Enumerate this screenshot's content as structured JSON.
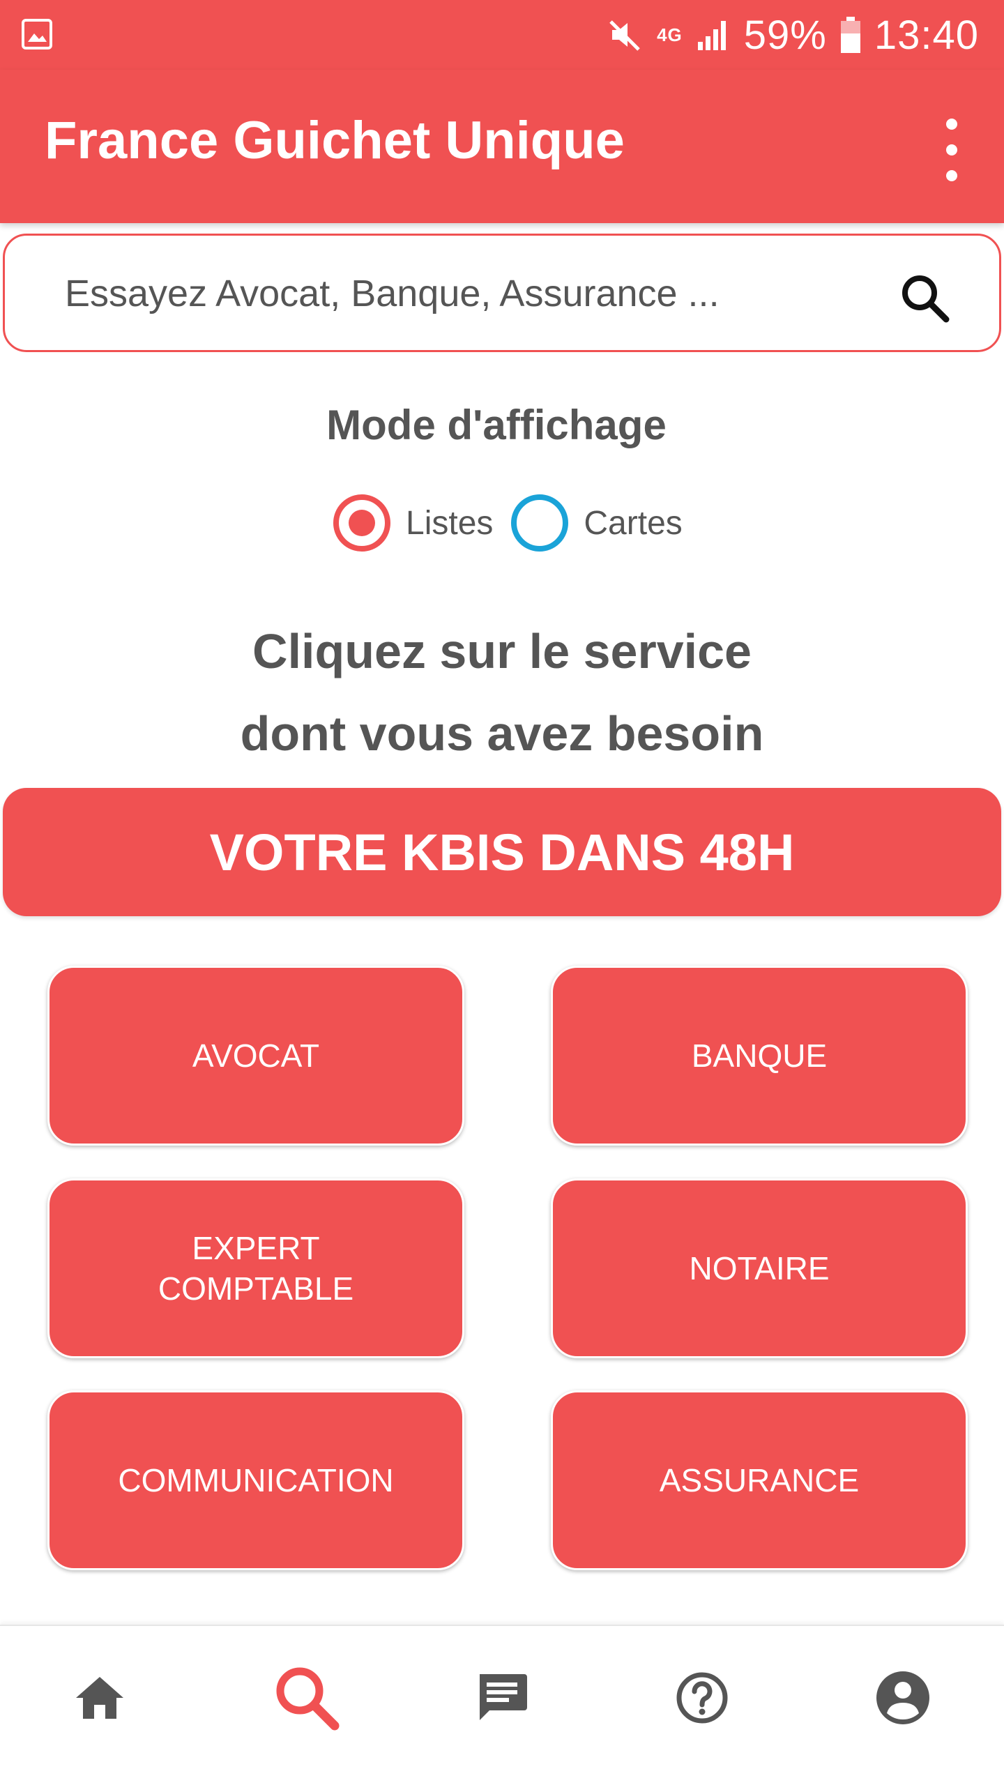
{
  "status_bar": {
    "battery_percent": "59%",
    "time": "13:40",
    "network": "4G",
    "icons": [
      "gallery-icon",
      "mute-icon",
      "4g-icon",
      "signal-icon",
      "battery-icon"
    ]
  },
  "app_bar": {
    "title": "France Guichet Unique",
    "menu_icon": "more-vert-icon"
  },
  "search": {
    "placeholder": "Essayez Avocat, Banque, Assurance ...",
    "value": "",
    "icon": "search-icon"
  },
  "display_mode": {
    "title": "Mode d'affichage",
    "options": [
      {
        "label": "Listes",
        "selected": true
      },
      {
        "label": "Cartes",
        "selected": false
      }
    ]
  },
  "prompt": {
    "line1": "Cliquez sur le service",
    "line2": "dont vous avez besoin"
  },
  "kbis_button": {
    "label": "VOTRE KBIS DANS 48H"
  },
  "services": [
    {
      "label": "AVOCAT"
    },
    {
      "label": "BANQUE"
    },
    {
      "label": "EXPERT\nCOMPTABLE"
    },
    {
      "label": "NOTAIRE"
    },
    {
      "label": "COMMUNICATION"
    },
    {
      "label": "ASSURANCE"
    }
  ],
  "bottom_nav": {
    "items": [
      {
        "icon": "home-icon",
        "active": false
      },
      {
        "icon": "search-icon",
        "active": true
      },
      {
        "icon": "chat-icon",
        "active": false
      },
      {
        "icon": "help-icon",
        "active": false
      },
      {
        "icon": "account-icon",
        "active": false
      }
    ]
  },
  "colors": {
    "primary": "#f05152",
    "text": "#555555",
    "icon_inactive": "#555555",
    "radio_unselected": "#1aa3d8"
  }
}
